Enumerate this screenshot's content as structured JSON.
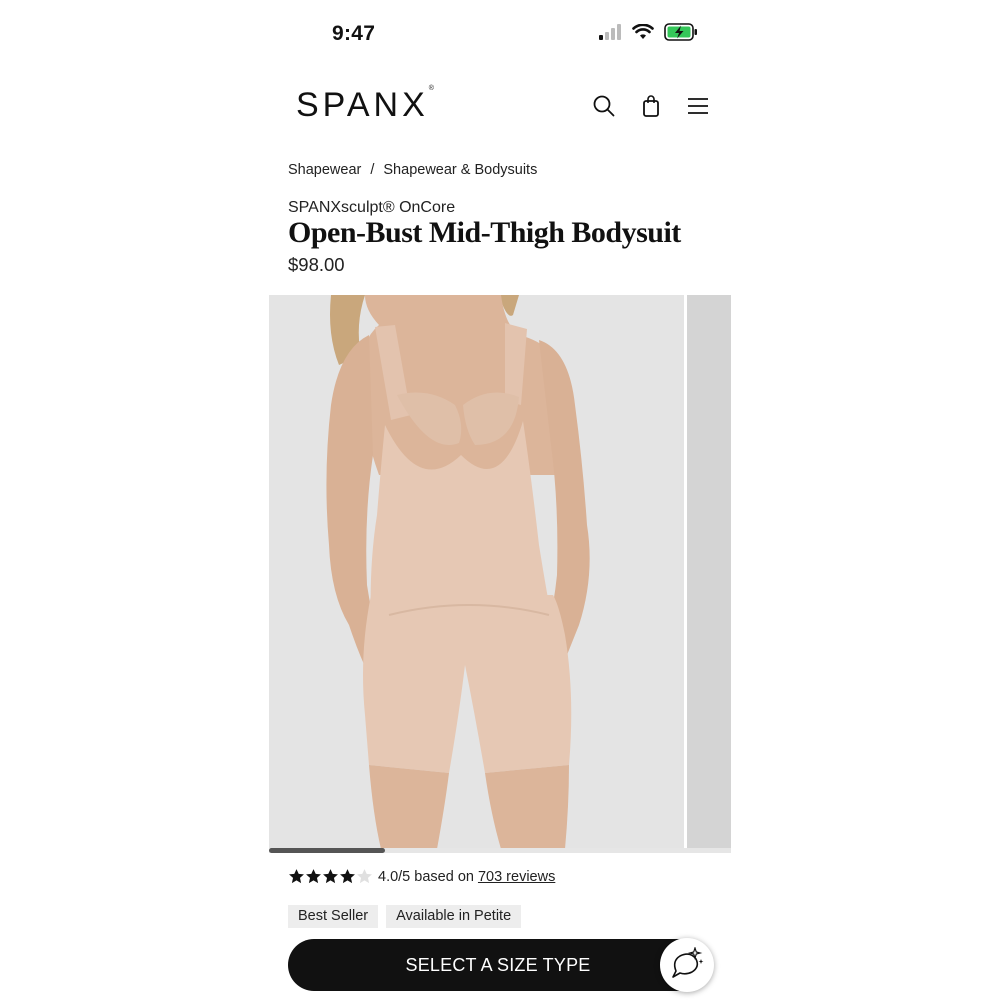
{
  "status_bar": {
    "time": "9:47"
  },
  "header": {
    "logo": "SPANX",
    "logo_mark": "®",
    "icons": [
      "search-icon",
      "shopping-bag-icon",
      "hamburger-menu-icon"
    ]
  },
  "breadcrumb": {
    "items": [
      "Shapewear",
      "Shapewear & Bodysuits"
    ],
    "separator": "/"
  },
  "product": {
    "subtitle": "SPANXsculpt® OnCore",
    "title": "Open-Bust Mid-Thigh Bodysuit",
    "price": "$98.00"
  },
  "gallery": {
    "progress_fraction": 0.25
  },
  "rating": {
    "stars_filled": 4,
    "stars_total": 5,
    "text": "4.0/5 based on",
    "reviews_link": "703 reviews"
  },
  "badges": [
    "Best Seller",
    "Available in Petite"
  ],
  "cta": {
    "label": "SELECT A SIZE TYPE"
  },
  "colors": {
    "primary": "#111111",
    "badge_bg": "#ededed",
    "gallery_bg": "#e4e4e4",
    "battery_green": "#34c759",
    "garment": "#e6c8b4"
  }
}
